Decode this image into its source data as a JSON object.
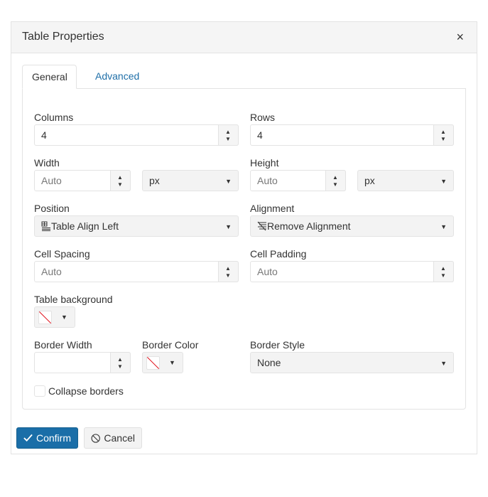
{
  "dialog": {
    "title": "Table Properties",
    "close_label": "×"
  },
  "tabs": [
    {
      "label": "General",
      "active": true
    },
    {
      "label": "Advanced",
      "active": false
    }
  ],
  "fields": {
    "columns": {
      "label": "Columns",
      "value": "4"
    },
    "rows": {
      "label": "Rows",
      "value": "4"
    },
    "width": {
      "label": "Width",
      "placeholder": "Auto",
      "unit": "px"
    },
    "height": {
      "label": "Height",
      "placeholder": "Auto",
      "unit": "px"
    },
    "position": {
      "label": "Position",
      "value": "Table Align Left",
      "icon": "table-align-left-icon"
    },
    "alignment": {
      "label": "Alignment",
      "value": "Remove Alignment",
      "icon": "remove-alignment-icon"
    },
    "cell_spacing": {
      "label": "Cell Spacing",
      "placeholder": "Auto"
    },
    "cell_padding": {
      "label": "Cell Padding",
      "placeholder": "Auto"
    },
    "table_background": {
      "label": "Table background",
      "color": "none"
    },
    "border_width": {
      "label": "Border Width",
      "value": ""
    },
    "border_color": {
      "label": "Border Color",
      "color": "none"
    },
    "border_style": {
      "label": "Border Style",
      "value": "None"
    },
    "collapse_borders": {
      "label": "Collapse borders",
      "checked": false
    }
  },
  "buttons": {
    "confirm": "Confirm",
    "cancel": "Cancel"
  },
  "colors": {
    "primary": "#1a6ea8",
    "link": "#1f6fa8",
    "no_color_slash": "#e0141e"
  }
}
